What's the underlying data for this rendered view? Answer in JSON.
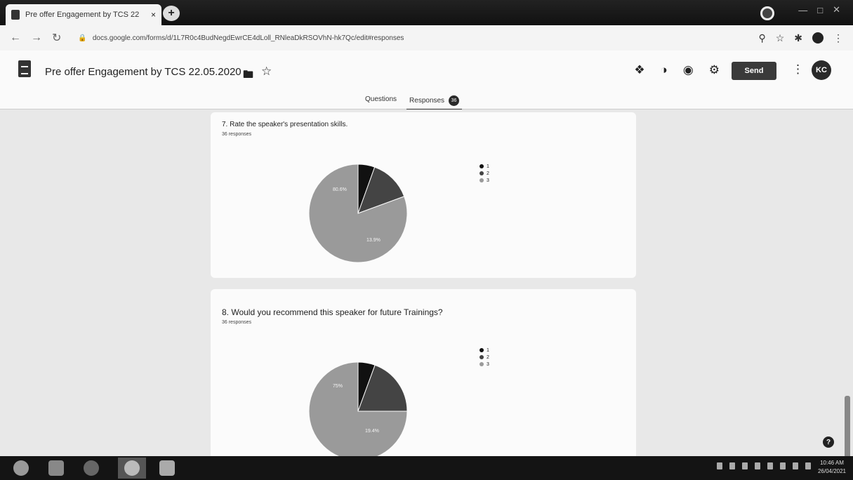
{
  "browser": {
    "tab_title": "Pre offer Engagement by TCS 22",
    "tab_close": "×",
    "new_tab": "+",
    "url": "docs.google.com/forms/d/1L7R0c4BudNegdEwrCE4dLoll_RNleaDkRSOVhN-hk7Qc/edit#responses"
  },
  "form_header": {
    "title": "Pre offer Engagement by TCS  22.05.2020",
    "send_label": "Send",
    "avatar_initials": "KC",
    "tabs": {
      "questions": "Questions",
      "responses": "Responses",
      "responses_count": "36"
    }
  },
  "questions": [
    {
      "title": "7. Rate the speaker's presentation skills.",
      "responses_label": "36 responses",
      "labels": {
        "big": "80.6%",
        "small": "13.9%"
      },
      "legend": [
        "1",
        "2",
        "3"
      ]
    },
    {
      "title": "8. Would you recommend this speaker for future Trainings?",
      "responses_label": "36 responses",
      "labels": {
        "big": "75%",
        "small": "19.4%"
      },
      "legend": [
        "1",
        "2",
        "3"
      ]
    }
  ],
  "chart_data": [
    {
      "type": "pie",
      "title": "7. Rate the speaker's presentation skills.",
      "categories": [
        "1",
        "2",
        "3"
      ],
      "values": [
        5.5,
        13.9,
        80.6
      ],
      "colors": [
        "#111111",
        "#444444",
        "#9a9a9a"
      ]
    },
    {
      "type": "pie",
      "title": "8. Would you recommend this speaker for future Trainings?",
      "categories": [
        "1",
        "2",
        "3"
      ],
      "values": [
        5.6,
        19.4,
        75
      ],
      "colors": [
        "#111111",
        "#444444",
        "#9a9a9a"
      ]
    }
  ],
  "taskbar": {
    "clock_time": "10:46 AM",
    "clock_date": "26/04/2021"
  },
  "help_glyph": "?"
}
